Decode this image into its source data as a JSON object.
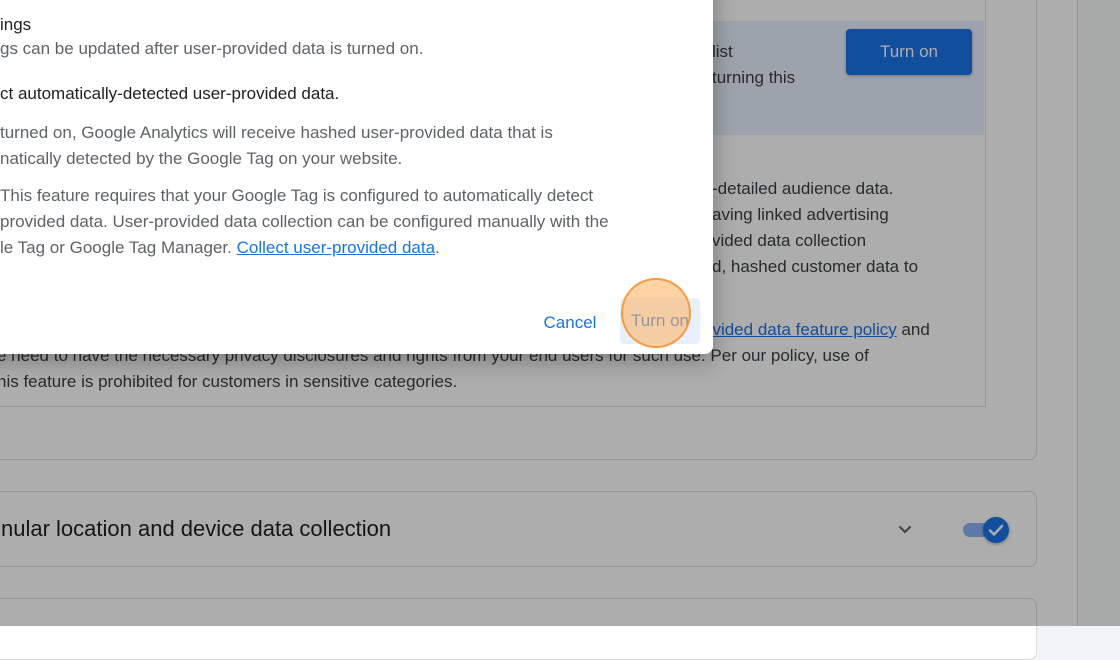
{
  "background": {
    "banner_lines": [
      "list",
      "turning this"
    ],
    "turn_on_button": "Turn on",
    "body_lines": [
      "-detailed audience data.",
      "aving linked advertising",
      "vided data collection",
      "d, hashed customer data to"
    ],
    "policy_link": "ovided data feature policy",
    "policy_after": " and",
    "policy_line2": "e need to have the necessary privacy disclosures and rights from your end users for such use. Per our policy, use of",
    "policy_line3": "his feature is prohibited for customers in sensitive categories.",
    "granular_title": "nular location and device data collection"
  },
  "dialog": {
    "settings_heading": "ings",
    "settings_text": "gs can be updated after user-provided data is turned on.",
    "option_label": "ct automatically-detected user-provided data.",
    "desc_line1": " turned on, Google Analytics will receive hashed user-provided data that is",
    "desc_line2": "natically detected by the Google Tag on your website.",
    "note_line1": " This feature requires that your Google Tag is configured to automatically detect",
    "note_line2": "provided data. User-provided data collection can be configured manually with the",
    "note_line3_prefix": "le Tag or Google Tag Manager. ",
    "note_link": "Collect user-provided data",
    "note_line3_suffix": ".",
    "cancel_label": "Cancel",
    "turn_on_label": "Turn on"
  },
  "colors": {
    "accent": "#1a73e8",
    "banner": "#e8f0fe",
    "scrim": "rgba(0,0,0,0.32)",
    "click_indicator": "#ffb05a"
  },
  "toggle": {
    "granular_enabled": true
  }
}
